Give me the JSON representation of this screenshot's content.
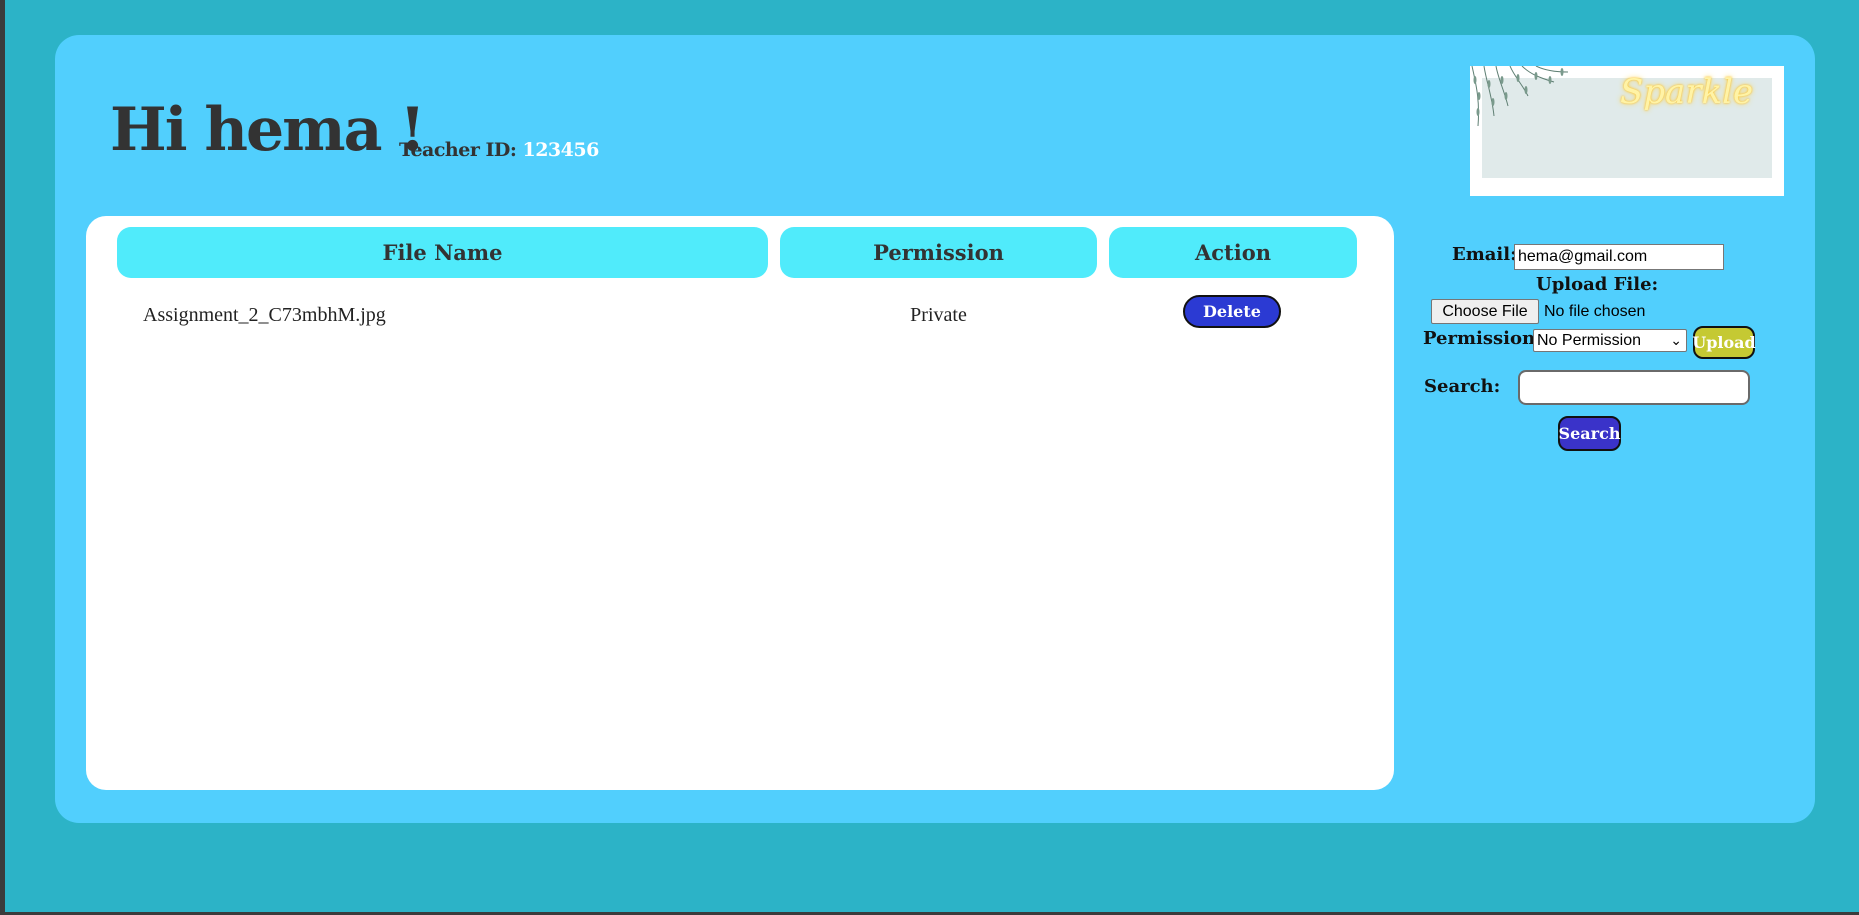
{
  "header": {
    "greeting": "Hi hema !",
    "teacher_id_label": "Teacher ID:",
    "teacher_id_value": "123456"
  },
  "banner": {
    "text": "Sparkle"
  },
  "table": {
    "columns": [
      "File Name",
      "Permission",
      "Action"
    ],
    "rows": [
      {
        "file_name": "Assignment_2_C73mbhM.jpg",
        "permission": "Private",
        "action": "Delete"
      }
    ]
  },
  "sidebar": {
    "email_label": "Email:",
    "email_value": "hema@gmail.com",
    "upload_file_label": "Upload File:",
    "choose_file_label": "Choose File",
    "no_file_text": "No file chosen",
    "permission_label": "Permission:",
    "permission_selected": "No Permission",
    "upload_button": "Upload",
    "search_label": "Search:",
    "search_value": "",
    "search_button": "Search"
  },
  "colors": {
    "page_background": "#2cb3c7",
    "card_background": "#51cffd",
    "table_header": "#50ebfb",
    "delete_button": "#2b3ad3",
    "upload_button": "#c5c933",
    "search_button": "#3a33c9"
  }
}
